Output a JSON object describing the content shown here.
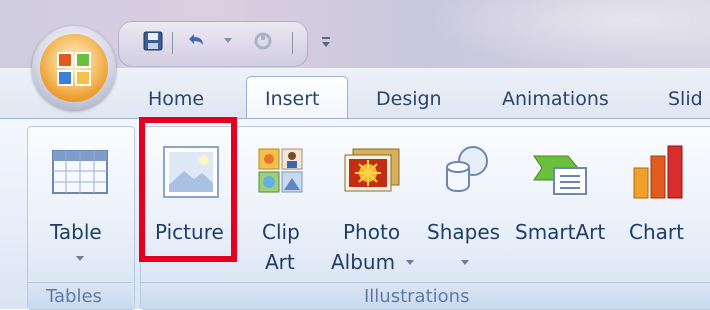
{
  "tabs": {
    "home": "Home",
    "insert": "Insert",
    "design": "Design",
    "animations": "Animations",
    "slide_show": "Slid"
  },
  "ribbon": {
    "table": "Table",
    "picture": "Picture",
    "clip_art_line1": "Clip",
    "clip_art_line2": "Art",
    "photo_album_line1": "Photo",
    "photo_album_line2": "Album",
    "shapes": "Shapes",
    "smartart": "SmartArt",
    "chart": "Chart"
  },
  "groups": {
    "tables": "Tables",
    "illustrations": "Illustrations"
  },
  "icons": {
    "save": "save-icon",
    "undo": "undo-icon",
    "redo": "redo-icon",
    "customize": "customize-qat-icon"
  },
  "colors": {
    "highlight": "#e5001f",
    "accent_orange": "#e88f1e"
  }
}
